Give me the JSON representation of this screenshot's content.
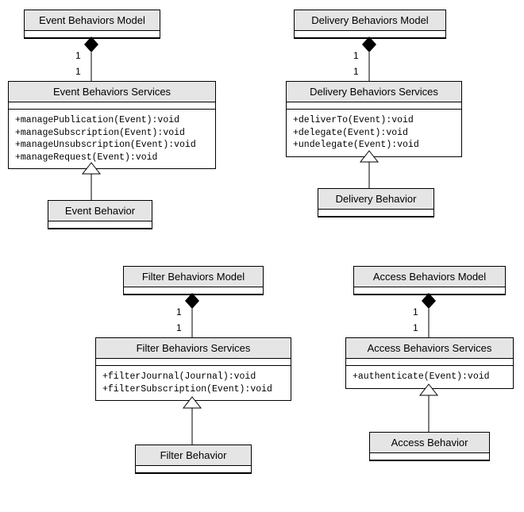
{
  "event": {
    "model": "Event Behaviors Model",
    "services": "Event Behaviors Services",
    "op1": "+managePublication(Event):void",
    "op2": "+manageSubscription(Event):void",
    "op3": "+manageUnsubscription(Event):void",
    "op4": "+manageRequest(Event):void",
    "behavior": "Event Behavior"
  },
  "delivery": {
    "model": "Delivery Behaviors Model",
    "services": "Delivery Behaviors Services",
    "op1": "+deliverTo(Event):void",
    "op2": "+delegate(Event):void",
    "op3": "+undelegate(Event):void",
    "behavior": "Delivery Behavior"
  },
  "filter": {
    "model": "Filter Behaviors Model",
    "services": "Filter Behaviors Services",
    "op1": "+filterJournal(Journal):void",
    "op2": "+filterSubscription(Event):void",
    "behavior": "Filter Behavior"
  },
  "access": {
    "model": "Access Behaviors Model",
    "services": "Access Behaviors Services",
    "op1": "+authenticate(Event):void",
    "behavior": "Access Behavior"
  },
  "mult": {
    "one_top_a": "1",
    "one_top_b": "1",
    "one_top_c": "1",
    "one_top_d": "1",
    "one_bot_a": "1",
    "one_bot_b": "1",
    "one_bot_c": "1",
    "one_bot_d": "1"
  },
  "chart_data": {
    "type": "uml-class-diagram",
    "groups": [
      {
        "model": "Event Behaviors Model",
        "services": {
          "name": "Event Behaviors Services",
          "operations": [
            "+managePublication(Event):void",
            "+manageSubscription(Event):void",
            "+manageUnsubscription(Event):void",
            "+manageRequest(Event):void"
          ]
        },
        "behavior": "Event Behavior",
        "relations": [
          {
            "from": "Event Behaviors Model",
            "to": "Event Behaviors Services",
            "type": "composition",
            "mult_from": "1",
            "mult_to": "1"
          },
          {
            "from": "Event Behavior",
            "to": "Event Behaviors Services",
            "type": "generalization"
          }
        ]
      },
      {
        "model": "Delivery Behaviors Model",
        "services": {
          "name": "Delivery Behaviors Services",
          "operations": [
            "+deliverTo(Event):void",
            "+delegate(Event):void",
            "+undelegate(Event):void"
          ]
        },
        "behavior": "Delivery Behavior",
        "relations": [
          {
            "from": "Delivery Behaviors Model",
            "to": "Delivery Behaviors Services",
            "type": "composition",
            "mult_from": "1",
            "mult_to": "1"
          },
          {
            "from": "Delivery Behavior",
            "to": "Delivery Behaviors Services",
            "type": "generalization"
          }
        ]
      },
      {
        "model": "Filter Behaviors Model",
        "services": {
          "name": "Filter Behaviors Services",
          "operations": [
            "+filterJournal(Journal):void",
            "+filterSubscription(Event):void"
          ]
        },
        "behavior": "Filter Behavior",
        "relations": [
          {
            "from": "Filter Behaviors Model",
            "to": "Filter Behaviors Services",
            "type": "composition",
            "mult_from": "1",
            "mult_to": "1"
          },
          {
            "from": "Filter Behavior",
            "to": "Filter Behaviors Services",
            "type": "generalization"
          }
        ]
      },
      {
        "model": "Access Behaviors Model",
        "services": {
          "name": "Access Behaviors Services",
          "operations": [
            "+authenticate(Event):void"
          ]
        },
        "behavior": "Access Behavior",
        "relations": [
          {
            "from": "Access Behaviors Model",
            "to": "Access Behaviors Services",
            "type": "composition",
            "mult_from": "1",
            "mult_to": "1"
          },
          {
            "from": "Access Behavior",
            "to": "Access Behaviors Services",
            "type": "generalization"
          }
        ]
      }
    ]
  }
}
